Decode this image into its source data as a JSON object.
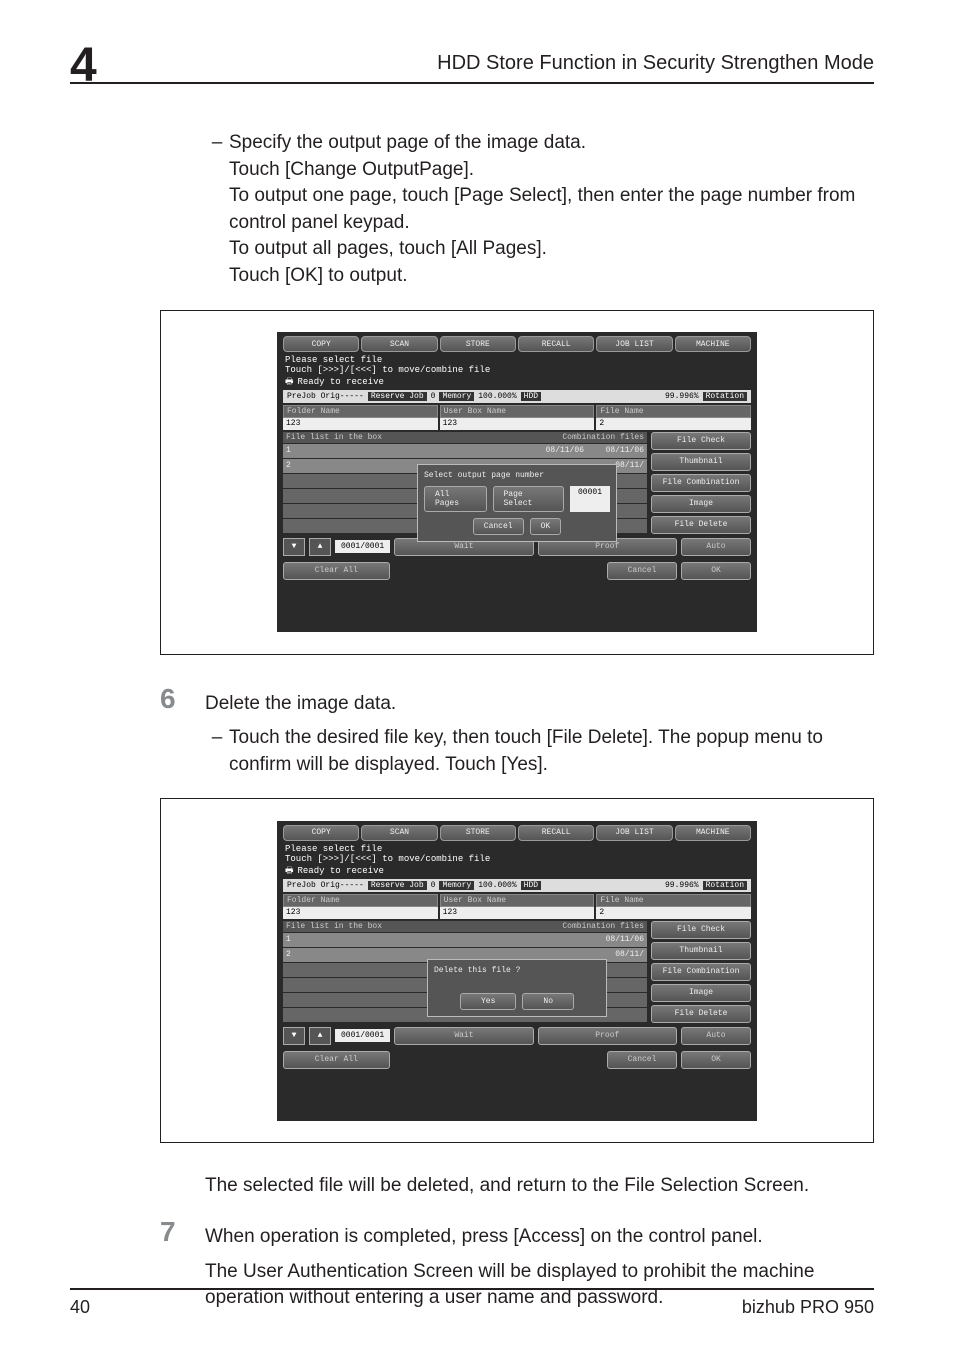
{
  "page": {
    "chapter_num": "4",
    "header_title": "HDD Store Function in Security Strengthen Mode",
    "footer_page": "40",
    "footer_product": "bizhub PRO 950"
  },
  "bullets": {
    "b1_line1": "Specify the output page of the image data.",
    "b1_line2": "Touch [Change OutputPage].",
    "b1_line3": "To output one page, touch [Page Select], then enter the page number from control panel keypad.",
    "b1_line4": "To output all pages, touch [All Pages].",
    "b1_line5": "Touch [OK] to output."
  },
  "step6": {
    "num": "6",
    "text": "Delete the image data.",
    "sub": "Touch the desired file key, then touch [File Delete]. The popup menu to confirm will be displayed. Touch [Yes]."
  },
  "after6": "The selected file will be deleted, and return to the File Selection Screen.",
  "step7": {
    "num": "7",
    "text": "When operation is completed, press [Access] on the control panel.",
    "para": "The User Authentication Screen will be displayed to prohibit the machine operation without entering a user name and password."
  },
  "mock": {
    "tabs": {
      "copy": "COPY",
      "scan": "SCAN",
      "store": "STORE",
      "recall": "RECALL",
      "joblist": "JOB LIST",
      "machine": "MACHINE"
    },
    "msg1": "Please select file",
    "msg2": "Touch [>>>]/[<<<] to move/combine file",
    "ready": "Ready to receive",
    "status": {
      "prejob": "PreJob Orig-----",
      "reserve": "Reserve Job",
      "mem_n": "0",
      "mem_l": "Memory",
      "mem_v": "100.000%",
      "hdd_l": "HDD",
      "hdd_v": "99.996%",
      "rot": "Rotation"
    },
    "cols": {
      "folder": "Folder Name",
      "userbox": "User Box Name",
      "file": "File Name"
    },
    "inputs": {
      "folder": "123",
      "userbox": "123",
      "file": "2"
    },
    "list": {
      "head_left": "File list in the box",
      "head_right": "Combination files",
      "row1_idx": "1",
      "row1_date": "08/11/06",
      "row2_idx": "2",
      "row2_date": "08/11/",
      "row2b_date": "08/11/06"
    },
    "right_btns": {
      "check": "File Check",
      "thumb": "Thumbnail",
      "comb": "File Combination",
      "image": "Image",
      "del": "File Delete"
    },
    "popup1": {
      "title": "Select output page number",
      "all": "All Pages",
      "select": "Page Select",
      "num": "00001",
      "cancel": "Cancel",
      "ok": "OK"
    },
    "popup2": {
      "title": "Delete this file ?",
      "yes": "Yes",
      "no": "No"
    },
    "bottom": {
      "count": "0001/0001",
      "wait": "Wait",
      "proof": "Proof",
      "auto": "Auto",
      "clear": "Clear All",
      "cancel": "Cancel",
      "ok": "OK"
    }
  }
}
